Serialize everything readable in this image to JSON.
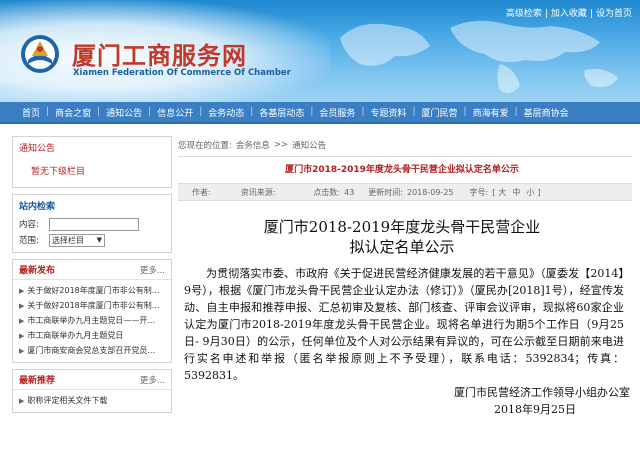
{
  "header": {
    "title": "厦门工商服务网",
    "subtitle": "Xiamen Federation Of Commerce Of Chamber",
    "toplinks": [
      "高级检索",
      "加入收藏",
      "设为首页"
    ]
  },
  "nav": {
    "items": [
      "首页",
      "商会之窗",
      "通知公告",
      "信息公开",
      "会务动态",
      "各基层动态",
      "会员服务",
      "专题资料",
      "厦门民营",
      "商海有爱",
      "基层商协会"
    ]
  },
  "sidebar": {
    "notice": {
      "title": "通知公告",
      "empty": "暂无下级栏目"
    },
    "search": {
      "title": "站内检索",
      "content_label": "内容:",
      "content_value": "",
      "scope_label": "范围:",
      "scope_value": "选择栏目"
    },
    "latest": {
      "title": "最新发布",
      "more": "更多...",
      "items": [
        "关于做好2018年度厦门市非公有制...",
        "关于做好2018年度厦门市非公有制...",
        "市工商联举办九月主题党日——开...",
        "市工商联举办九月主题党日",
        "厦门市商安商会党总支部召开党员..."
      ]
    },
    "recommend": {
      "title": "最新推荐",
      "more": "更多...",
      "items": [
        "职称评定相关文件下载"
      ]
    }
  },
  "breadcrumb": {
    "prefix": "您现在的位置:",
    "items": [
      "会务信息",
      "通知公告"
    ],
    "separator": ">>"
  },
  "main": {
    "page_title": "厦门市2018-2019年度龙头骨干民营企业拟认定名单公示",
    "meta": {
      "author_label": "作者:",
      "author": "",
      "source_label": "资讯来源:",
      "source": "",
      "views_label": "点击数:",
      "views": "43",
      "date_label": "更新时间:",
      "date": "2018-09-25",
      "font_label": "字号:",
      "font_open": "[",
      "font_sizes": [
        "大",
        "中",
        "小"
      ],
      "font_close": "]"
    },
    "article": {
      "title_line1": "厦门市2018-2019年度龙头骨干民营企业",
      "title_line2": "拟认定名单公示",
      "body": "为贯彻落实市委、市政府《关于促进民营经济健康发展的若干意见》（厦委发【2014】9号），根据《厦门市龙头骨干民营企业认定办法（修订）》（厦民办[2018]1号），经宣传发动、自主申报和推荐申报、汇总初审及复核、部门核查、评审会议评审，现拟将60家企业认定为厦门市2018-2019年度龙头骨干民营企业。现将名单进行为期5个工作日（9月25日- 9月30日）的公示，任何单位及个人对公示结果有异议的，可在公示截至日期前来电进行实名申述和举报（匿名举报原则上不予受理），联系电话：5392834；传真：5392831。",
      "signature": "厦门市民营经济工作领导小组办公室",
      "sign_date": "2018年9月25日"
    }
  }
}
